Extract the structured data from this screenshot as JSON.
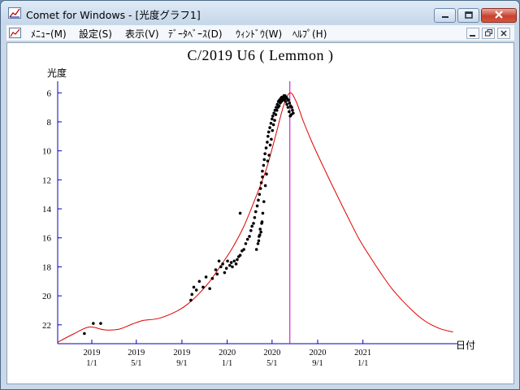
{
  "window": {
    "title": "Comet for Windows - [光度グラフ1]",
    "app_icon": "graph-icon"
  },
  "caption_buttons": {
    "minimize_icon": "minimize-icon",
    "maximize_icon": "maximize-icon",
    "close_icon": "close-icon"
  },
  "menu": {
    "items": [
      {
        "label": "ﾒﾆｭｰ(M)"
      },
      {
        "label": "設定(S)"
      },
      {
        "label": "表示(V)"
      },
      {
        "label": "ﾃﾞｰﾀﾍﾞｰｽ(D)"
      },
      {
        "label": "ｳｨﾝﾄﾞｳ(W)"
      },
      {
        "label": "ﾍﾙﾌﾟ(H)"
      }
    ]
  },
  "colors": {
    "curve": "#e00000",
    "perihelion_line": "#c000c0",
    "axis": "#0000c0",
    "points": "#000000"
  },
  "chart_data": {
    "type": "scatter",
    "title": "C/2019 U6 ( Lemmon )",
    "ylabel": "光度",
    "xlabel": "日付",
    "y_inverted": true,
    "ylim": [
      23.3,
      5.2
    ],
    "xlim": [
      "2018-10-01",
      "2021-09-15"
    ],
    "y_ticks": [
      6,
      8,
      10,
      12,
      14,
      16,
      18,
      20,
      22
    ],
    "x_ticks": [
      {
        "date": "2019-01-01",
        "year": "2019",
        "md": "1/1"
      },
      {
        "date": "2019-05-01",
        "year": "2019",
        "md": "5/1"
      },
      {
        "date": "2019-09-01",
        "year": "2019",
        "md": "9/1"
      },
      {
        "date": "2020-01-01",
        "year": "2020",
        "md": "1/1"
      },
      {
        "date": "2020-05-01",
        "year": "2020",
        "md": "5/1"
      },
      {
        "date": "2020-09-01",
        "year": "2020",
        "md": "9/1"
      },
      {
        "date": "2021-01-01",
        "year": "2021",
        "md": "1/1"
      }
    ],
    "perihelion_date": "2020-06-18",
    "predicted_curve": {
      "name": "",
      "dates": [
        "2018-10-01",
        "2018-11-15",
        "2018-12-25",
        "2019-02-05",
        "2019-03-15",
        "2019-04-20",
        "2019-05-20",
        "2019-07-01",
        "2019-08-15",
        "2019-09-15",
        "2019-10-15",
        "2019-11-15",
        "2019-12-15",
        "2020-01-15",
        "2020-02-15",
        "2020-03-15",
        "2020-04-15",
        "2020-05-10",
        "2020-06-01",
        "2020-06-18",
        "2020-07-05",
        "2020-07-25",
        "2020-08-20",
        "2020-09-20",
        "2020-10-20",
        "2020-11-20",
        "2020-12-20",
        "2021-01-20",
        "2021-02-20",
        "2021-03-20",
        "2021-04-20",
        "2021-05-20",
        "2021-06-15",
        "2021-07-05",
        "2021-08-01",
        "2021-09-01"
      ],
      "mags": [
        23.2,
        22.6,
        22.15,
        22.35,
        22.3,
        21.95,
        21.7,
        21.55,
        21.1,
        20.6,
        19.9,
        19.0,
        17.9,
        16.7,
        15.2,
        13.4,
        11.3,
        9.0,
        6.9,
        6.0,
        6.6,
        8.0,
        9.6,
        11.3,
        12.9,
        14.5,
        16.0,
        17.3,
        18.5,
        19.5,
        20.4,
        21.15,
        21.7,
        22.0,
        22.3,
        22.5
      ]
    },
    "observations": {
      "dates": [
        "2018-12-12",
        "2019-01-05",
        "2019-01-25",
        "2019-09-25",
        "2019-09-28",
        "2019-10-03",
        "2019-10-10",
        "2019-10-18",
        "2019-10-28",
        "2019-11-05",
        "2019-11-15",
        "2019-11-22",
        "2019-12-01",
        "2019-12-05",
        "2019-12-10",
        "2019-12-15",
        "2019-12-20",
        "2019-12-25",
        "2019-12-30",
        "2020-01-02",
        "2020-01-08",
        "2020-01-12",
        "2020-01-15",
        "2020-01-20",
        "2020-01-25",
        "2020-01-28",
        "2020-02-01",
        "2020-02-05",
        "2020-02-05",
        "2020-02-10",
        "2020-02-15",
        "2020-02-20",
        "2020-02-25",
        "2020-03-01",
        "2020-03-05",
        "2020-03-08",
        "2020-03-12",
        "2020-03-15",
        "2020-03-18",
        "2020-03-22",
        "2020-03-25",
        "2020-03-28",
        "2020-03-31",
        "2020-04-02",
        "2020-04-05",
        "2020-04-05",
        "2020-04-08",
        "2020-04-10",
        "2020-04-12",
        "2020-04-15",
        "2020-04-18",
        "2020-04-20",
        "2020-04-22",
        "2020-04-25",
        "2020-04-28",
        "2020-05-01",
        "2020-05-03",
        "2020-05-06",
        "2020-05-09",
        "2020-05-12",
        "2020-05-15",
        "2020-05-18",
        "2020-05-21",
        "2020-05-24",
        "2020-05-27",
        "2020-05-30",
        "2020-06-02",
        "2020-06-05",
        "2020-06-08",
        "2020-06-11",
        "2020-06-14",
        "2020-06-17",
        "2020-06-20",
        "2020-06-23",
        "2020-06-25",
        "2020-06-27",
        "2020-03-20",
        "2020-03-24",
        "2020-03-27",
        "2020-03-30",
        "2020-04-03",
        "2020-03-26",
        "2020-04-01",
        "2020-04-06",
        "2020-03-29",
        "2020-04-04",
        "2020-04-09",
        "2020-04-13",
        "2020-04-16",
        "2020-04-19",
        "2020-04-23",
        "2020-04-26",
        "2020-04-29",
        "2020-05-02",
        "2020-05-05",
        "2020-05-08",
        "2020-05-11",
        "2020-05-14",
        "2020-05-17",
        "2020-05-20",
        "2020-05-23",
        "2020-05-26",
        "2020-05-29",
        "2020-06-01",
        "2020-06-04",
        "2020-06-07",
        "2020-06-10",
        "2020-06-13",
        "2020-06-16",
        "2020-06-19",
        "2020-06-22"
      ],
      "mags": [
        22.6,
        21.9,
        21.9,
        20.3,
        19.9,
        19.4,
        19.6,
        19.0,
        19.4,
        18.7,
        19.5,
        18.8,
        18.2,
        18.5,
        17.6,
        18.0,
        17.8,
        18.4,
        18.1,
        17.6,
        17.9,
        17.7,
        18.0,
        17.6,
        17.8,
        17.5,
        17.3,
        14.3,
        17.2,
        16.9,
        16.8,
        16.4,
        16.1,
        15.9,
        15.5,
        15.2,
        15.0,
        14.6,
        14.2,
        13.8,
        13.4,
        13.0,
        12.6,
        12.2,
        11.8,
        11.4,
        11.0,
        10.6,
        10.2,
        9.8,
        9.4,
        9.0,
        8.7,
        8.4,
        8.1,
        7.8,
        7.6,
        7.4,
        7.2,
        7.0,
        6.8,
        6.6,
        6.5,
        6.4,
        6.3,
        6.3,
        6.2,
        6.2,
        6.3,
        6.4,
        6.5,
        6.7,
        6.9,
        7.0,
        7.2,
        7.4,
        16.8,
        16.4,
        15.9,
        15.4,
        15.0,
        16.2,
        15.6,
        14.3,
        15.8,
        14.9,
        13.5,
        12.4,
        11.6,
        10.7,
        10.3,
        9.6,
        9.2,
        8.6,
        8.2,
        7.9,
        7.5,
        7.2,
        7.0,
        6.9,
        6.7,
        6.6,
        6.5,
        6.5,
        6.4,
        6.6,
        6.8,
        7.0,
        7.3,
        7.6,
        7.5
      ]
    }
  }
}
